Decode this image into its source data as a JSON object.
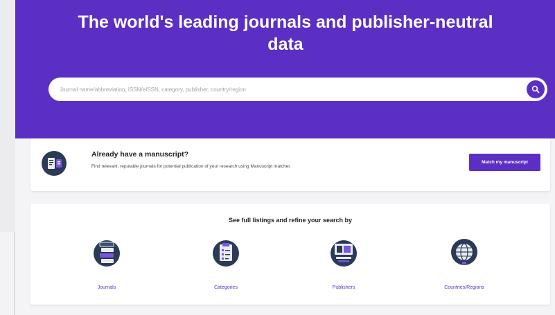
{
  "hero": {
    "title": "The world's leading journals and publisher-neutral data"
  },
  "search": {
    "placeholder": "Journal name/abbreviation, ISSN/eISSN, category, publisher, country/region",
    "button_icon": "search-icon"
  },
  "manuscript": {
    "heading": "Already have a manuscript?",
    "description": "Find relevant, reputable journals for potential publication of your research using Manuscript matcher.",
    "button_label": "Match my manuscript",
    "icon": "manuscript-icon"
  },
  "listings": {
    "heading": "See full listings and refine your search by",
    "items": [
      {
        "label": "Journals",
        "icon": "journals-icon"
      },
      {
        "label": "Categories",
        "icon": "categories-icon"
      },
      {
        "label": "Publishers",
        "icon": "publishers-icon"
      },
      {
        "label": "Countries/Regions",
        "icon": "globe-icon"
      }
    ]
  },
  "colors": {
    "brand_purple": "#5b2fc4",
    "icon_dark": "#2b3a55",
    "background": "#f4f4f6"
  }
}
